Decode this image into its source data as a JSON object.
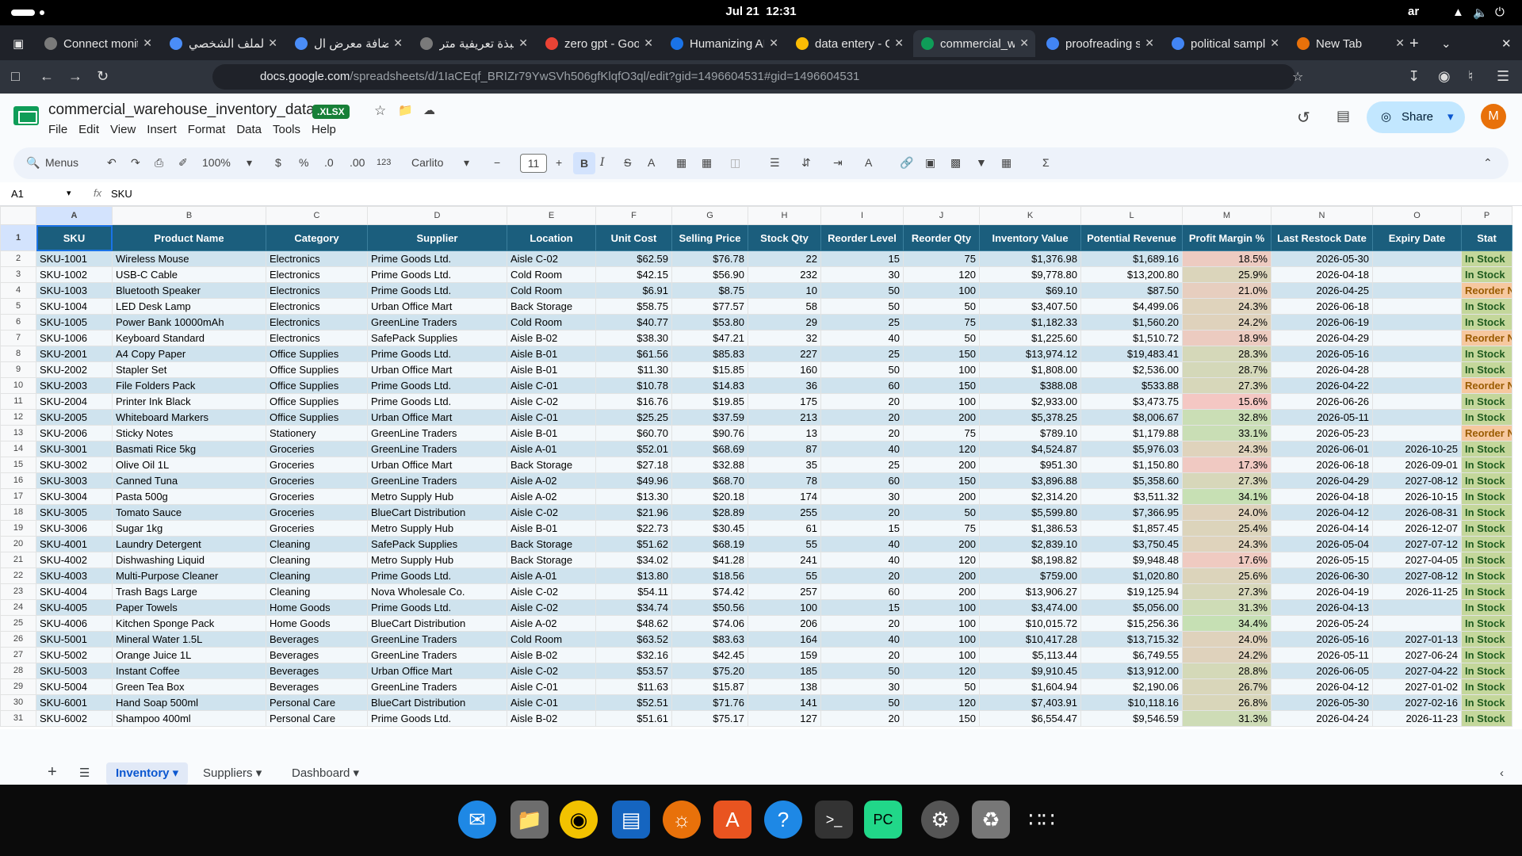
{
  "system": {
    "date": "Jul 21",
    "time": "12:31",
    "lang": "ar"
  },
  "tabs": [
    {
      "title": "Connect monit",
      "color": "#7a7a7a"
    },
    {
      "title": "الملف الشخصي",
      "color": "#4a8df8"
    },
    {
      "title": "إضافة معرض ال",
      "color": "#4a8df8"
    },
    {
      "title": "نبذة تعريفية متر",
      "color": "#7a7a7a"
    },
    {
      "title": "zero gpt - Goo",
      "color": "#ea4335"
    },
    {
      "title": "Humanizing AI",
      "color": "#1a73e8"
    },
    {
      "title": "data entery - G",
      "color": "#fbbc04"
    },
    {
      "title": "commercial_w",
      "color": "#0f9d58"
    },
    {
      "title": "proofreading s",
      "color": "#4285f4"
    },
    {
      "title": "political sampl",
      "color": "#4285f4"
    },
    {
      "title": "New Tab",
      "color": "#e8710a"
    }
  ],
  "url": {
    "host": "docs.google.com",
    "path": "/spreadsheets/d/1IaCEqf_BRIZr79YwSVh506gfKlqfO3ql/edit?gid=1496604531#gid=1496604531"
  },
  "doc": {
    "title": "commercial_warehouse_inventory_data",
    "badge": ".XLSX"
  },
  "menu": [
    "File",
    "Edit",
    "View",
    "Insert",
    "Format",
    "Data",
    "Tools",
    "Help"
  ],
  "share_label": "Share",
  "avatar": "M",
  "toolbar": {
    "menus": "Menus",
    "zoom": "100%",
    "currency": "$",
    "percent": "%",
    "dec_less": ".0",
    "dec_more": ".00",
    "fmt": "123",
    "font": "Carlito",
    "font_size": "11"
  },
  "formula": {
    "cell": "A1",
    "value": "SKU"
  },
  "columns": [
    "A",
    "B",
    "C",
    "D",
    "E",
    "F",
    "G",
    "H",
    "I",
    "J",
    "K",
    "L",
    "M",
    "N",
    "O",
    "P"
  ],
  "headers": [
    "SKU",
    "Product Name",
    "Category",
    "Supplier",
    "Location",
    "Unit Cost",
    "Selling Price",
    "Stock Qty",
    "Reorder Level",
    "Reorder Qty",
    "Inventory Value",
    "Potential Revenue",
    "Profit Margin %",
    "Last Restock Date",
    "Expiry Date",
    "Stat"
  ],
  "rows": [
    [
      "SKU-1001",
      "Wireless Mouse",
      "Electronics",
      "Prime Goods Ltd.",
      "Aisle C-02",
      "$62.59",
      "$76.78",
      "22",
      "15",
      "75",
      "$1,376.98",
      "$1,689.16",
      "18.5%",
      "2026-05-30",
      "",
      "In Stock"
    ],
    [
      "SKU-1002",
      "USB-C Cable",
      "Electronics",
      "Prime Goods Ltd.",
      "Cold Room",
      "$42.15",
      "$56.90",
      "232",
      "30",
      "120",
      "$9,778.80",
      "$13,200.80",
      "25.9%",
      "2026-04-18",
      "",
      "In Stock"
    ],
    [
      "SKU-1003",
      "Bluetooth Speaker",
      "Electronics",
      "Prime Goods Ltd.",
      "Cold Room",
      "$6.91",
      "$8.75",
      "10",
      "50",
      "100",
      "$69.10",
      "$87.50",
      "21.0%",
      "2026-04-25",
      "",
      "Reorder N"
    ],
    [
      "SKU-1004",
      "LED Desk Lamp",
      "Electronics",
      "Urban Office Mart",
      "Back Storage",
      "$58.75",
      "$77.57",
      "58",
      "50",
      "50",
      "$3,407.50",
      "$4,499.06",
      "24.3%",
      "2026-06-18",
      "",
      "In Stock"
    ],
    [
      "SKU-1005",
      "Power Bank 10000mAh",
      "Electronics",
      "GreenLine Traders",
      "Cold Room",
      "$40.77",
      "$53.80",
      "29",
      "25",
      "75",
      "$1,182.33",
      "$1,560.20",
      "24.2%",
      "2026-06-19",
      "",
      "In Stock"
    ],
    [
      "SKU-1006",
      "Keyboard Standard",
      "Electronics",
      "SafePack Supplies",
      "Aisle B-02",
      "$38.30",
      "$47.21",
      "32",
      "40",
      "50",
      "$1,225.60",
      "$1,510.72",
      "18.9%",
      "2026-04-29",
      "",
      "Reorder N"
    ],
    [
      "SKU-2001",
      "A4 Copy Paper",
      "Office Supplies",
      "Prime Goods Ltd.",
      "Aisle B-01",
      "$61.56",
      "$85.83",
      "227",
      "25",
      "150",
      "$13,974.12",
      "$19,483.41",
      "28.3%",
      "2026-05-16",
      "",
      "In Stock"
    ],
    [
      "SKU-2002",
      "Stapler Set",
      "Office Supplies",
      "Urban Office Mart",
      "Aisle B-01",
      "$11.30",
      "$15.85",
      "160",
      "50",
      "100",
      "$1,808.00",
      "$2,536.00",
      "28.7%",
      "2026-04-28",
      "",
      "In Stock"
    ],
    [
      "SKU-2003",
      "File Folders Pack",
      "Office Supplies",
      "Prime Goods Ltd.",
      "Aisle C-01",
      "$10.78",
      "$14.83",
      "36",
      "60",
      "150",
      "$388.08",
      "$533.88",
      "27.3%",
      "2026-04-22",
      "",
      "Reorder N"
    ],
    [
      "SKU-2004",
      "Printer Ink Black",
      "Office Supplies",
      "Prime Goods Ltd.",
      "Aisle C-02",
      "$16.76",
      "$19.85",
      "175",
      "20",
      "100",
      "$2,933.00",
      "$3,473.75",
      "15.6%",
      "2026-06-26",
      "",
      "In Stock"
    ],
    [
      "SKU-2005",
      "Whiteboard Markers",
      "Office Supplies",
      "Urban Office Mart",
      "Aisle C-01",
      "$25.25",
      "$37.59",
      "213",
      "20",
      "200",
      "$5,378.25",
      "$8,006.67",
      "32.8%",
      "2026-05-11",
      "",
      "In Stock"
    ],
    [
      "SKU-2006",
      "Sticky Notes",
      "Stationery",
      "GreenLine Traders",
      "Aisle B-01",
      "$60.70",
      "$90.76",
      "13",
      "20",
      "75",
      "$789.10",
      "$1,179.88",
      "33.1%",
      "2026-05-23",
      "",
      "Reorder N"
    ],
    [
      "SKU-3001",
      "Basmati Rice 5kg",
      "Groceries",
      "GreenLine Traders",
      "Aisle A-01",
      "$52.01",
      "$68.69",
      "87",
      "40",
      "120",
      "$4,524.87",
      "$5,976.03",
      "24.3%",
      "2026-06-01",
      "2026-10-25",
      "In Stock"
    ],
    [
      "SKU-3002",
      "Olive Oil 1L",
      "Groceries",
      "Urban Office Mart",
      "Back Storage",
      "$27.18",
      "$32.88",
      "35",
      "25",
      "200",
      "$951.30",
      "$1,150.80",
      "17.3%",
      "2026-06-18",
      "2026-09-01",
      "In Stock"
    ],
    [
      "SKU-3003",
      "Canned Tuna",
      "Groceries",
      "GreenLine Traders",
      "Aisle A-02",
      "$49.96",
      "$68.70",
      "78",
      "60",
      "150",
      "$3,896.88",
      "$5,358.60",
      "27.3%",
      "2026-04-29",
      "2027-08-12",
      "In Stock"
    ],
    [
      "SKU-3004",
      "Pasta 500g",
      "Groceries",
      "Metro Supply Hub",
      "Aisle A-02",
      "$13.30",
      "$20.18",
      "174",
      "30",
      "200",
      "$2,314.20",
      "$3,511.32",
      "34.1%",
      "2026-04-18",
      "2026-10-15",
      "In Stock"
    ],
    [
      "SKU-3005",
      "Tomato Sauce",
      "Groceries",
      "BlueCart Distribution",
      "Aisle C-02",
      "$21.96",
      "$28.89",
      "255",
      "20",
      "50",
      "$5,599.80",
      "$7,366.95",
      "24.0%",
      "2026-04-12",
      "2026-08-31",
      "In Stock"
    ],
    [
      "SKU-3006",
      "Sugar 1kg",
      "Groceries",
      "Metro Supply Hub",
      "Aisle B-01",
      "$22.73",
      "$30.45",
      "61",
      "15",
      "75",
      "$1,386.53",
      "$1,857.45",
      "25.4%",
      "2026-04-14",
      "2026-12-07",
      "In Stock"
    ],
    [
      "SKU-4001",
      "Laundry Detergent",
      "Cleaning",
      "SafePack Supplies",
      "Back Storage",
      "$51.62",
      "$68.19",
      "55",
      "40",
      "200",
      "$2,839.10",
      "$3,750.45",
      "24.3%",
      "2026-05-04",
      "2027-07-12",
      "In Stock"
    ],
    [
      "SKU-4002",
      "Dishwashing Liquid",
      "Cleaning",
      "Metro Supply Hub",
      "Back Storage",
      "$34.02",
      "$41.28",
      "241",
      "40",
      "120",
      "$8,198.82",
      "$9,948.48",
      "17.6%",
      "2026-05-15",
      "2027-04-05",
      "In Stock"
    ],
    [
      "SKU-4003",
      "Multi-Purpose Cleaner",
      "Cleaning",
      "Prime Goods Ltd.",
      "Aisle A-01",
      "$13.80",
      "$18.56",
      "55",
      "20",
      "200",
      "$759.00",
      "$1,020.80",
      "25.6%",
      "2026-06-30",
      "2027-08-12",
      "In Stock"
    ],
    [
      "SKU-4004",
      "Trash Bags Large",
      "Cleaning",
      "Nova Wholesale Co.",
      "Aisle C-02",
      "$54.11",
      "$74.42",
      "257",
      "60",
      "200",
      "$13,906.27",
      "$19,125.94",
      "27.3%",
      "2026-04-19",
      "2026-11-25",
      "In Stock"
    ],
    [
      "SKU-4005",
      "Paper Towels",
      "Home Goods",
      "Prime Goods Ltd.",
      "Aisle C-02",
      "$34.74",
      "$50.56",
      "100",
      "15",
      "100",
      "$3,474.00",
      "$5,056.00",
      "31.3%",
      "2026-04-13",
      "",
      "In Stock"
    ],
    [
      "SKU-4006",
      "Kitchen Sponge Pack",
      "Home Goods",
      "BlueCart Distribution",
      "Aisle A-02",
      "$48.62",
      "$74.06",
      "206",
      "20",
      "100",
      "$10,015.72",
      "$15,256.36",
      "34.4%",
      "2026-05-24",
      "",
      "In Stock"
    ],
    [
      "SKU-5001",
      "Mineral Water 1.5L",
      "Beverages",
      "GreenLine Traders",
      "Cold Room",
      "$63.52",
      "$83.63",
      "164",
      "40",
      "100",
      "$10,417.28",
      "$13,715.32",
      "24.0%",
      "2026-05-16",
      "2027-01-13",
      "In Stock"
    ],
    [
      "SKU-5002",
      "Orange Juice 1L",
      "Beverages",
      "GreenLine Traders",
      "Aisle B-02",
      "$32.16",
      "$42.45",
      "159",
      "20",
      "100",
      "$5,113.44",
      "$6,749.55",
      "24.2%",
      "2026-05-11",
      "2027-06-24",
      "In Stock"
    ],
    [
      "SKU-5003",
      "Instant Coffee",
      "Beverages",
      "Urban Office Mart",
      "Aisle C-02",
      "$53.57",
      "$75.20",
      "185",
      "50",
      "120",
      "$9,910.45",
      "$13,912.00",
      "28.8%",
      "2026-06-05",
      "2027-04-22",
      "In Stock"
    ],
    [
      "SKU-5004",
      "Green Tea Box",
      "Beverages",
      "GreenLine Traders",
      "Aisle C-01",
      "$11.63",
      "$15.87",
      "138",
      "30",
      "50",
      "$1,604.94",
      "$2,190.06",
      "26.7%",
      "2026-04-12",
      "2027-01-02",
      "In Stock"
    ],
    [
      "SKU-6001",
      "Hand Soap 500ml",
      "Personal Care",
      "BlueCart Distribution",
      "Aisle C-01",
      "$52.51",
      "$71.76",
      "141",
      "50",
      "120",
      "$7,403.91",
      "$10,118.16",
      "26.8%",
      "2026-05-30",
      "2027-02-16",
      "In Stock"
    ],
    [
      "SKU-6002",
      "Shampoo 400ml",
      "Personal Care",
      "Prime Goods Ltd.",
      "Aisle B-02",
      "$51.61",
      "$75.17",
      "127",
      "20",
      "150",
      "$6,554.47",
      "$9,546.59",
      "31.3%",
      "2026-04-24",
      "2026-11-23",
      "In Stock"
    ]
  ],
  "sheets": [
    "Inventory",
    "Suppliers",
    "Dashboard"
  ],
  "colors": {
    "header": "#1b5e7d",
    "stock_ok": "#c4d79b",
    "stock_low": "#f6c89f"
  }
}
